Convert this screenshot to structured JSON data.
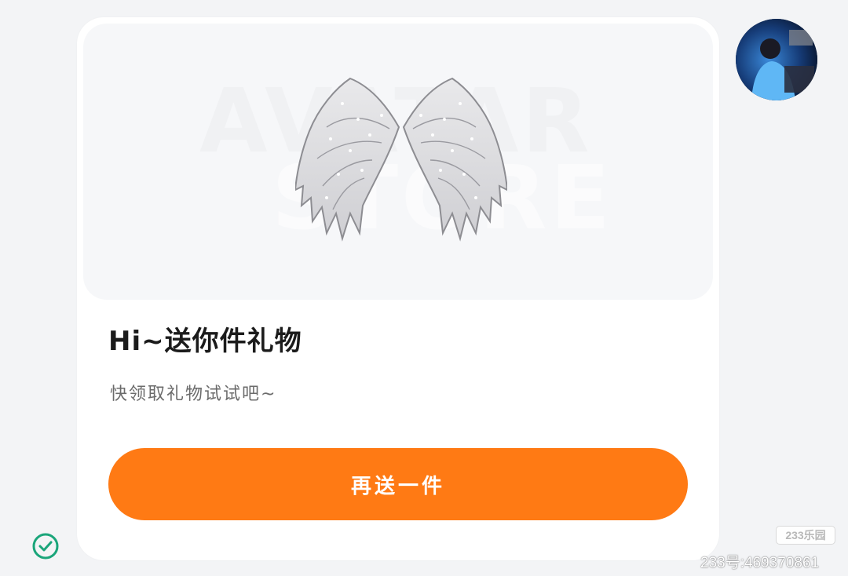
{
  "gift_card": {
    "watermark_line1": "AVATAR",
    "watermark_line2": "STORE",
    "title": "Hi~送你件礼物",
    "subtitle": "快领取礼物试试吧~",
    "cta_label": "再送一件",
    "item_icon": "angel-wings"
  },
  "status": {
    "icon": "check-circle-icon"
  },
  "footer_watermark": {
    "brand": "233乐园",
    "account": "233号:469370861"
  },
  "colors": {
    "accent": "#ff7a14",
    "check": "#1aa57a",
    "title_text": "#1b1b1b",
    "subtitle_text": "#6b6b6b"
  }
}
